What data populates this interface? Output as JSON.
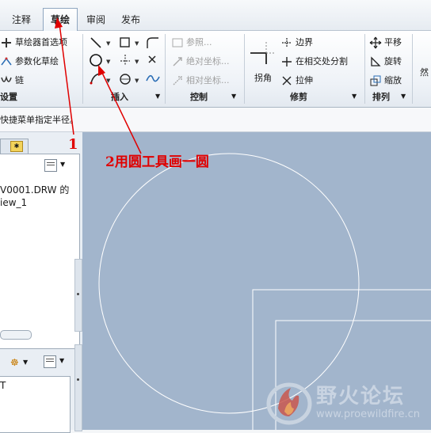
{
  "tabs": [
    {
      "label": "注释"
    },
    {
      "label": "草绘"
    },
    {
      "label": "审阅"
    },
    {
      "label": "发布"
    }
  ],
  "ribbon": {
    "settings": {
      "items": [
        "草绘器首选项",
        "参数化草绘",
        "链"
      ],
      "title": "设置"
    },
    "insert": {
      "title": "插入"
    },
    "control": {
      "items": [
        "参照...",
        "绝对坐标...",
        "相对坐标..."
      ],
      "title": "控制"
    },
    "trim": {
      "corner": "拐角",
      "items": [
        "边界",
        "在相交处分割",
        "拉伸"
      ],
      "title": "修剪"
    },
    "arrange": {
      "items": [
        "平移",
        "旋转",
        "缩放"
      ],
      "title": "排列"
    },
    "partial": "然"
  },
  "status_text": "快捷菜单指定半径。",
  "left_panel": {
    "tree_text_1": "V0001.DRW 的",
    "tree_text_2": "iew_1",
    "bottom_text": "T"
  },
  "annotations": {
    "step1": "1",
    "step2": "2用圆工具画一圆"
  },
  "watermark": {
    "title": "野火论坛",
    "url": "www.proewildfire.cn"
  }
}
